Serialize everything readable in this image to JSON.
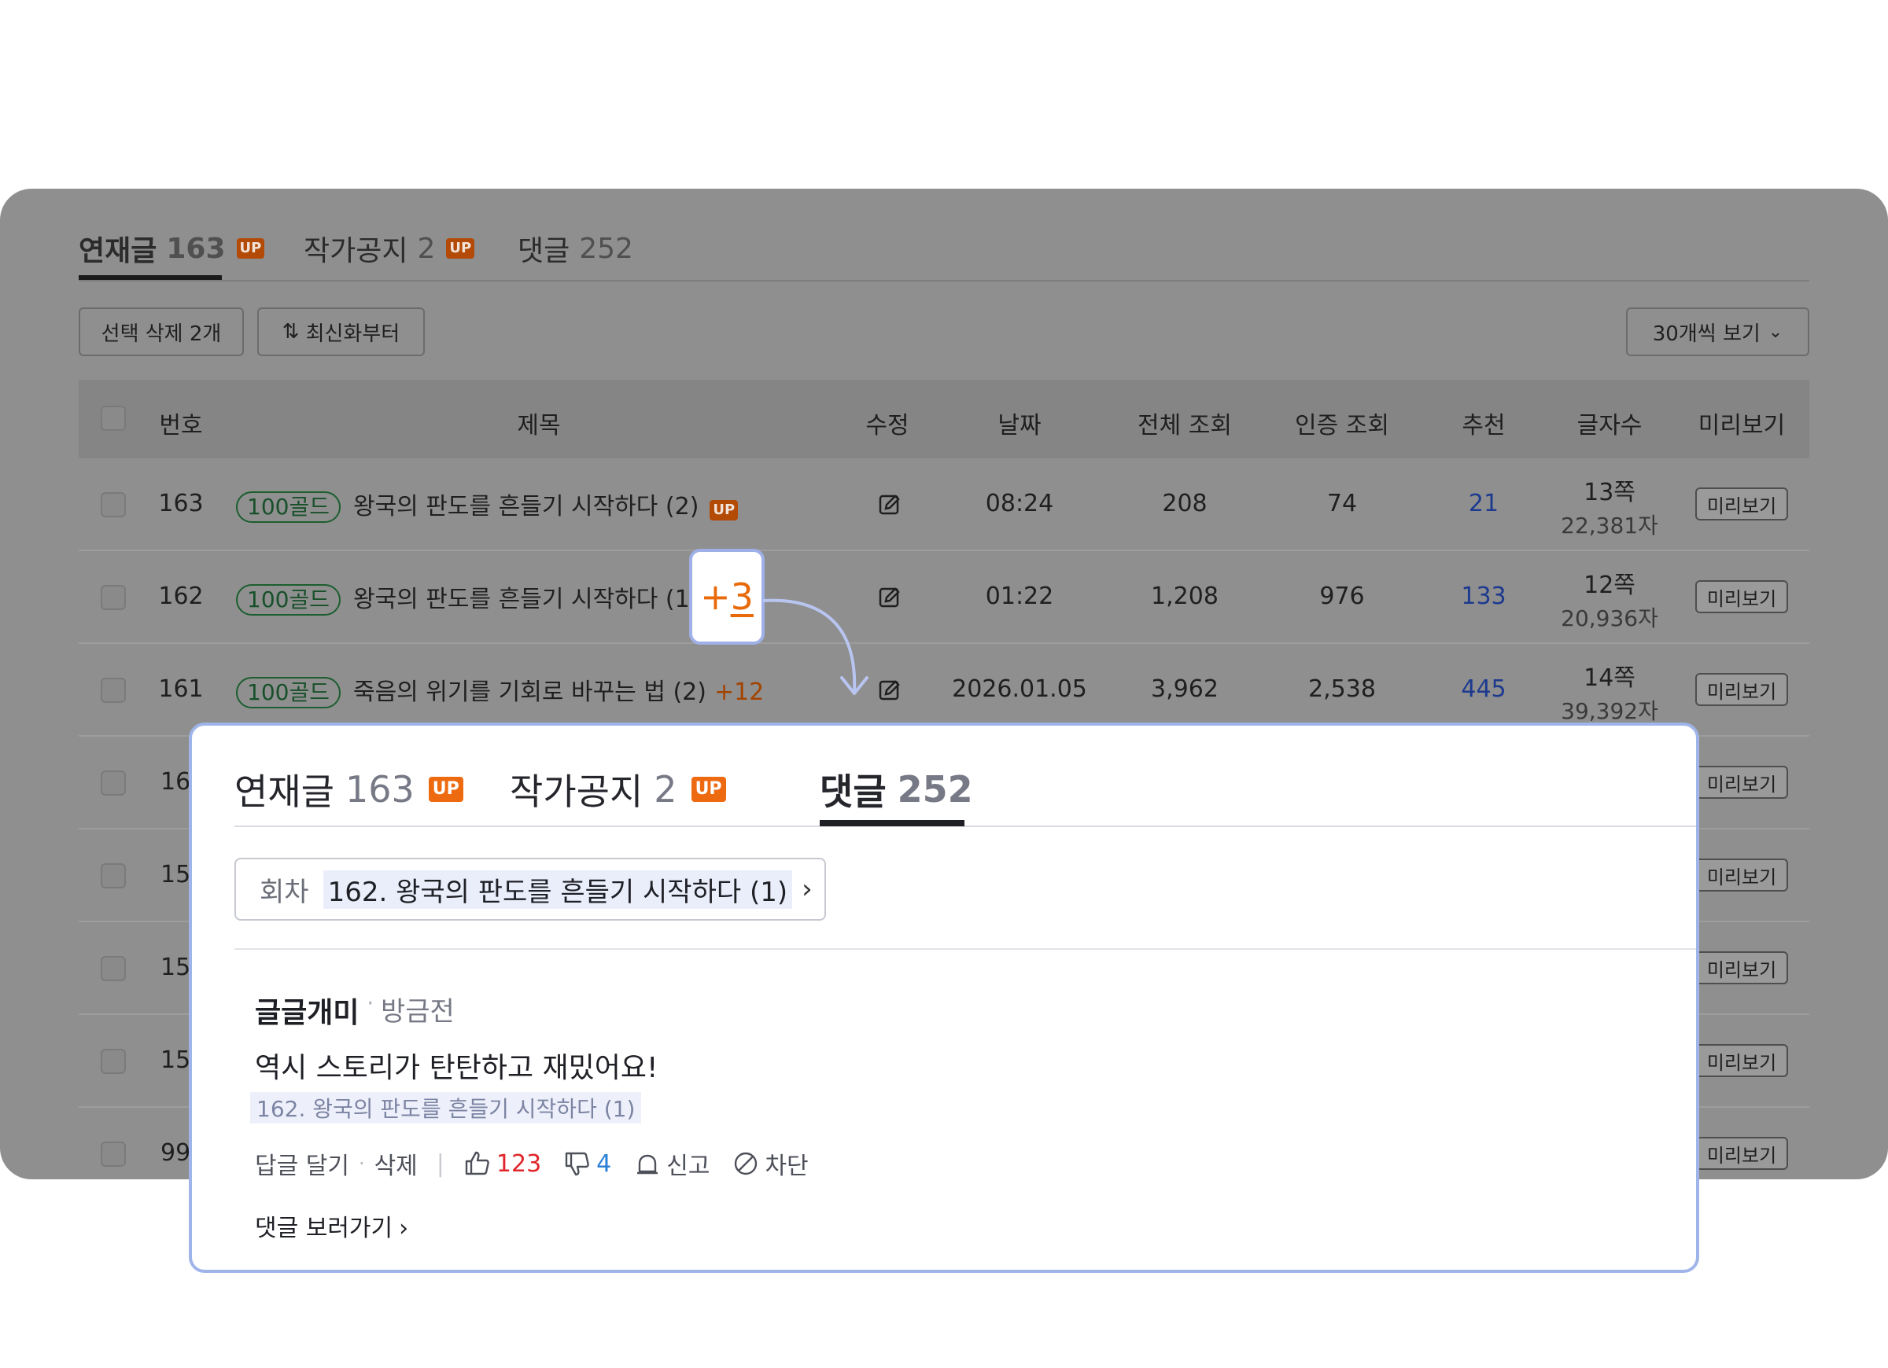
{
  "board": {
    "tabs": [
      {
        "label": "연재글",
        "count": "163",
        "badge": "UP"
      },
      {
        "label": "작가공지",
        "count": "2",
        "badge": "UP"
      },
      {
        "label": "댓글",
        "count": "252"
      }
    ],
    "delete_button": "선택 삭제 2개",
    "sort_button": "최신화부터",
    "per_page_select": "30개씩 보기",
    "columns": [
      "번호",
      "제목",
      "수정",
      "날짜",
      "전체 조회",
      "인증 조회",
      "추천",
      "글자수",
      "미리보기"
    ],
    "rows": [
      {
        "no": "163",
        "gold": "100골드",
        "title": "왕국의 판도를 흔들기 시작하다 (2)",
        "badge": "UP",
        "date": "08:24",
        "views": "208",
        "auth_views": "74",
        "rec": "21",
        "pages": "13쪽",
        "chars": "22,381자",
        "preview": "미리보기"
      },
      {
        "no": "162",
        "gold": "100골드",
        "title": "왕국의 판도를 흔들기 시작하다 (1)",
        "date": "01:22",
        "views": "1,208",
        "auth_views": "976",
        "rec": "133",
        "pages": "12쪽",
        "chars": "20,936자",
        "preview": "미리보기"
      },
      {
        "no": "161",
        "gold": "100골드",
        "title": "죽음의 위기를 기회로 바꾸는 법 (2)",
        "plus": "+12",
        "date": "2026.01.05",
        "views": "3,962",
        "auth_views": "2,538",
        "rec": "445",
        "pages": "14쪽",
        "chars": "39,392자",
        "preview": "미리보기"
      },
      {
        "no": "16",
        "preview": "미리보기"
      },
      {
        "no": "15",
        "preview": "미리보기"
      },
      {
        "no": "15",
        "preview": "미리보기"
      },
      {
        "no": "15",
        "preview": "미리보기"
      },
      {
        "no": "99",
        "preview": "미리보기"
      }
    ]
  },
  "badge_plus": {
    "sign": "+",
    "value": "3"
  },
  "comment_panel": {
    "tabs": [
      {
        "label": "연재글",
        "count": "163",
        "badge": "UP"
      },
      {
        "label": "작가공지",
        "count": "2",
        "badge": "UP"
      },
      {
        "label": "댓글",
        "count": "252"
      }
    ],
    "episode_label": "회차",
    "episode_title": "162. 왕국의 판도를 흔들기 시작하다 (1)",
    "comment": {
      "author": "글글개미",
      "time": "방금전",
      "body": "역시 스토리가 탄탄하고 재밌어요!",
      "ref": "162. 왕국의 판도를 흔들기 시작하다 (1)",
      "reply": "답글 달기",
      "delete": "삭제",
      "likes": "123",
      "dislikes": "4",
      "report": "신고",
      "block": "차단"
    },
    "more_link": "댓글 보러가기"
  },
  "colors": {
    "accent_orange": "#ee6a10",
    "card_border": "#9fb4e8",
    "like": "#e0262b",
    "dislike": "#2a7fd6"
  }
}
